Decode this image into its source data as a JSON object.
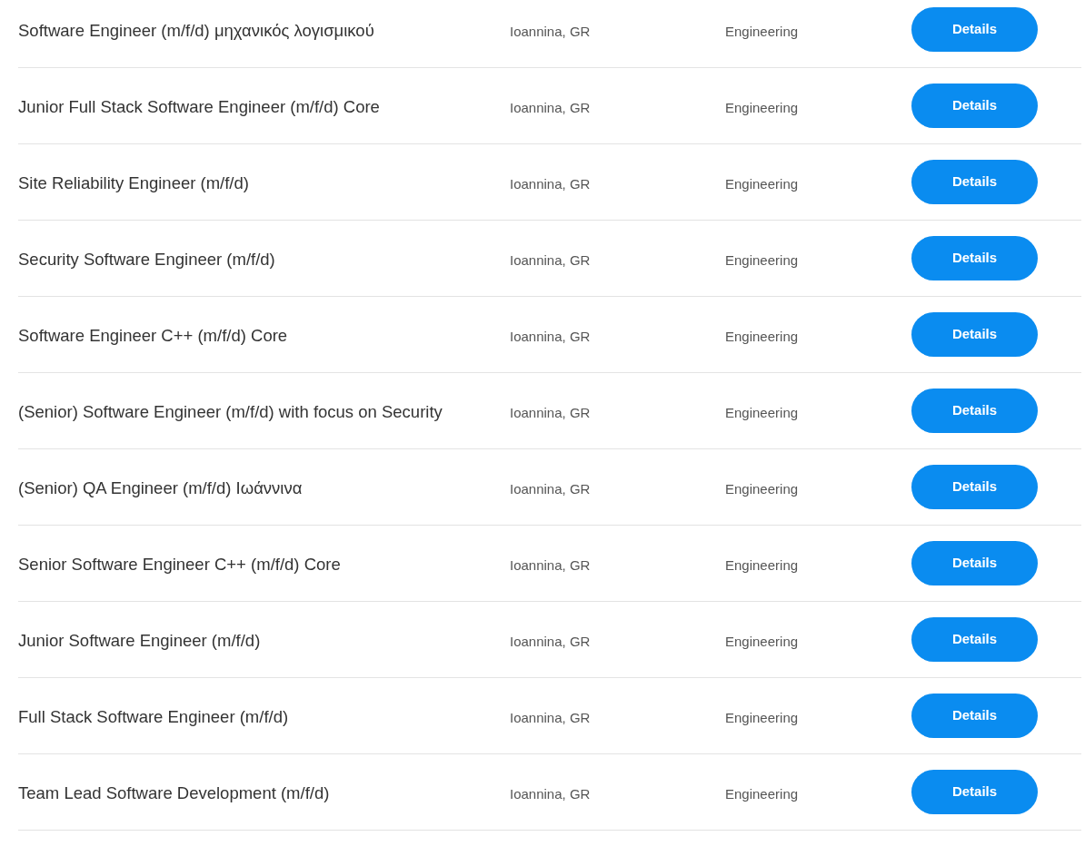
{
  "jobs": [
    {
      "title": "Software Engineer (m/f/d) μηχανικός λογισμικού",
      "location": "Ioannina, GR",
      "department": "Engineering",
      "button": "Details"
    },
    {
      "title": "Junior Full Stack Software Engineer (m/f/d) Core",
      "location": "Ioannina, GR",
      "department": "Engineering",
      "button": "Details"
    },
    {
      "title": "Site Reliability Engineer (m/f/d)",
      "location": "Ioannina, GR",
      "department": "Engineering",
      "button": "Details"
    },
    {
      "title": "Security Software Engineer (m/f/d)",
      "location": "Ioannina, GR",
      "department": "Engineering",
      "button": "Details"
    },
    {
      "title": "Software Engineer C++ (m/f/d) Core",
      "location": "Ioannina, GR",
      "department": "Engineering",
      "button": "Details"
    },
    {
      "title": "(Senior) Software Engineer (m/f/d) with focus on Security",
      "location": "Ioannina, GR",
      "department": "Engineering",
      "button": "Details"
    },
    {
      "title": "(Senior) QA Engineer (m/f/d) Ιωάννινα",
      "location": "Ioannina, GR",
      "department": "Engineering",
      "button": "Details"
    },
    {
      "title": "Senior Software Engineer C++ (m/f/d) Core",
      "location": "Ioannina, GR",
      "department": "Engineering",
      "button": "Details"
    },
    {
      "title": "Junior Software Engineer (m/f/d)",
      "location": "Ioannina, GR",
      "department": "Engineering",
      "button": "Details"
    },
    {
      "title": "Full Stack Software Engineer (m/f/d)",
      "location": "Ioannina, GR",
      "department": "Engineering",
      "button": "Details"
    },
    {
      "title": "Team Lead Software Development (m/f/d)",
      "location": "Ioannina, GR",
      "department": "Engineering",
      "button": "Details"
    }
  ]
}
